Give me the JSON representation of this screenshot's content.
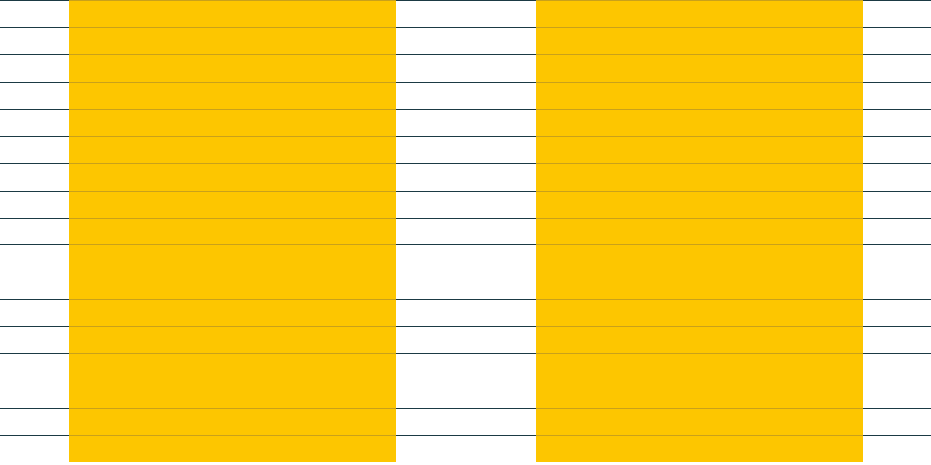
{
  "chart_data": {
    "type": "bar",
    "categories": [
      "",
      ""
    ],
    "values": [
      17,
      17
    ],
    "title": "",
    "xlabel": "",
    "ylabel": "",
    "ylim": [
      0,
      17
    ],
    "grid": true,
    "tick_labels_visible": false,
    "legend": "none"
  },
  "colors": {
    "background": "#ffffff",
    "bar": "#fdc600",
    "gridline": "#1b3a44",
    "gridline_over_bar": "#c9a11a"
  }
}
